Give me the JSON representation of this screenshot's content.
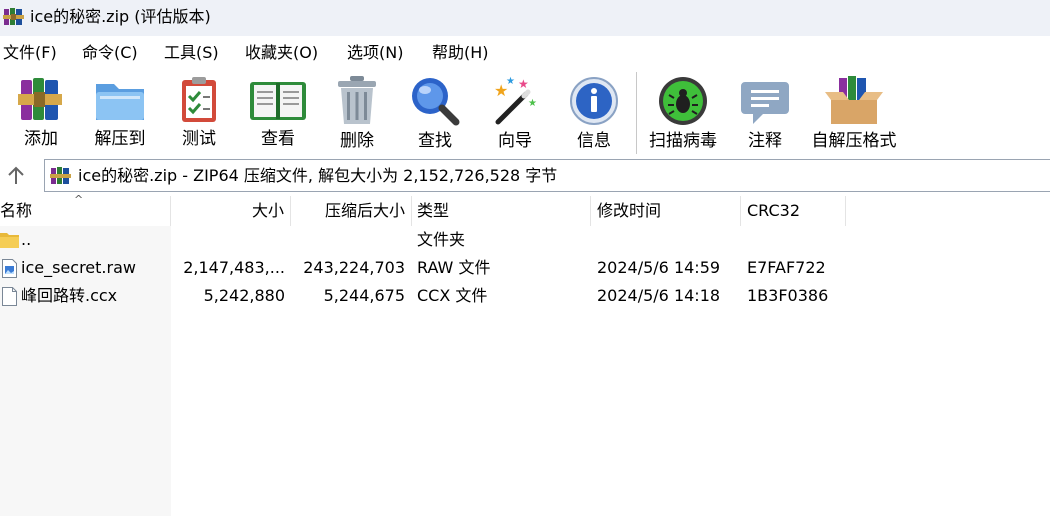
{
  "window": {
    "title": "ice的秘密.zip (评估版本)",
    "app_icon": "winrar-books-icon"
  },
  "menu": [
    {
      "label": "文件(F)"
    },
    {
      "label": "命令(C)"
    },
    {
      "label": "工具(S)"
    },
    {
      "label": "收藏夹(O)"
    },
    {
      "label": "选项(N)"
    },
    {
      "label": "帮助(H)"
    }
  ],
  "toolbar": [
    {
      "label": "添加",
      "icon": "add-archive-icon"
    },
    {
      "label": "解压到",
      "icon": "extract-folder-icon"
    },
    {
      "label": "测试",
      "icon": "test-clipboard-icon"
    },
    {
      "label": "查看",
      "icon": "view-book-icon"
    },
    {
      "label": "删除",
      "icon": "trash-can-icon"
    },
    {
      "label": "查找",
      "icon": "magnifier-icon"
    },
    {
      "label": "向导",
      "icon": "wizard-wand-icon"
    },
    {
      "label": "信息",
      "icon": "info-icon"
    },
    {
      "label": "扫描病毒",
      "icon": "virus-scan-icon"
    },
    {
      "label": "注释",
      "icon": "comment-bubble-icon"
    },
    {
      "label": "自解压格式",
      "icon": "sfx-box-icon"
    }
  ],
  "address": {
    "text": "ice的秘密.zip - ZIP64 压缩文件, 解包大小为 2,152,726,528 字节"
  },
  "columns": {
    "name": "名称",
    "size": "大小",
    "packed": "压缩后大小",
    "type": "类型",
    "modified": "修改时间",
    "crc": "CRC32",
    "sort_indicator": "^"
  },
  "files": [
    {
      "name": "..",
      "size": "",
      "packed": "",
      "type": "文件夹",
      "modified": "",
      "crc": "",
      "icon": "folder-icon"
    },
    {
      "name": "ice_secret.raw",
      "size": "2,147,483,...",
      "packed": "243,224,703",
      "type": "RAW 文件",
      "modified": "2024/5/6 14:59",
      "crc": "E7FAF722",
      "icon": "image-file-icon"
    },
    {
      "name": "峰回路转.ccx",
      "size": "5,242,880",
      "packed": "5,244,675",
      "type": "CCX 文件",
      "modified": "2024/5/6 14:18",
      "crc": "1B3F0386",
      "icon": "blank-file-icon"
    }
  ]
}
